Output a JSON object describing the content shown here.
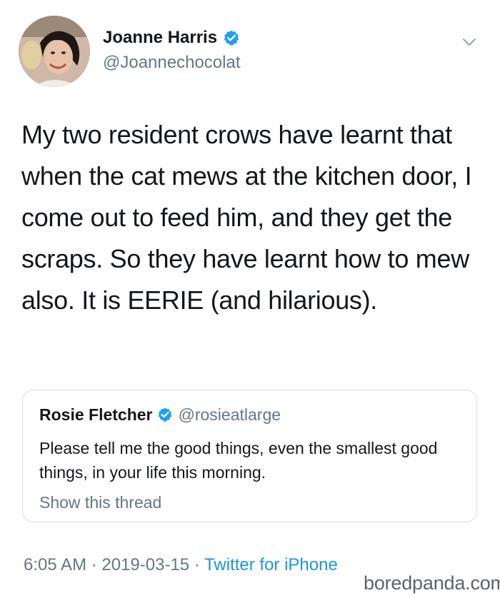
{
  "tweet": {
    "author": {
      "name": "Joanne Harris",
      "handle": "@Joannechocolat"
    },
    "text": "My two resident crows have learnt that when the cat mews at the kitchen door, I come out to feed him, and they get the scraps. So they have learnt how to mew also. It is EERIE (and hilarious).",
    "quote": {
      "name": "Rosie Fletcher",
      "handle": "@rosieatlarge",
      "text": "Please tell me the good things, even the smallest good things, in your life this morning.",
      "show_thread": "Show this thread"
    },
    "meta": {
      "time": "6:05 AM",
      "separator": " · ",
      "date": "2019-03-15",
      "source": "Twitter for iPhone"
    }
  },
  "watermark": "boredpanda.com",
  "colors": {
    "verified_blue": "#1da1f2",
    "link_blue": "#1b95e0",
    "secondary_text": "#657786",
    "primary_text": "#14171a"
  },
  "icons": {
    "verified": "verified-badge-icon",
    "menu": "chevron-down-icon"
  }
}
